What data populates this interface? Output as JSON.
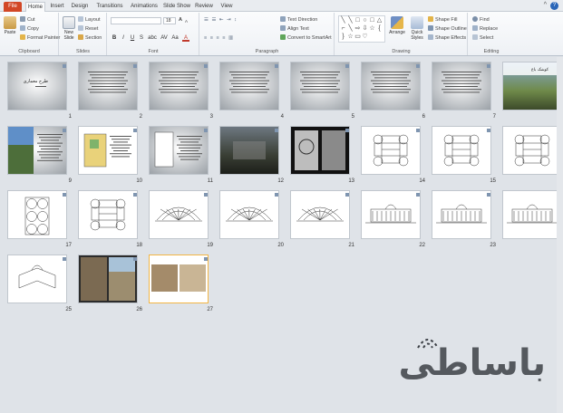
{
  "tabs": [
    "File",
    "Home",
    "Insert",
    "Design",
    "Transitions",
    "Animations",
    "Slide Show",
    "Review",
    "View"
  ],
  "active_tab": "Home",
  "help_label": "?",
  "minimize_label": "^",
  "groups": {
    "clipboard": {
      "label": "Clipboard",
      "paste": "Paste",
      "cut": "Cut",
      "copy": "Copy",
      "format_painter": "Format Painter"
    },
    "slides": {
      "label": "Slides",
      "new_slide": "New Slide",
      "layout": "Layout",
      "reset": "Reset",
      "section": "Section"
    },
    "font": {
      "label": "Font",
      "font_name": "",
      "font_size": "18",
      "bold": "B",
      "italic": "I",
      "underline": "U",
      "strike": "S",
      "shadow": "abc",
      "spacing": "AV",
      "case": "Aa",
      "color": "A"
    },
    "paragraph": {
      "label": "Paragraph",
      "text_direction": "Text Direction",
      "align_text": "Align Text",
      "smartart": "Convert to SmartArt"
    },
    "drawing": {
      "label": "Drawing",
      "arrange": "Arrange",
      "quick_styles": "Quick Styles",
      "shape_fill": "Shape Fill",
      "shape_outline": "Shape Outline",
      "shape_effects": "Shape Effects"
    },
    "editing": {
      "label": "Editing",
      "find": "Find",
      "replace": "Replace",
      "select": "Select"
    }
  },
  "slides": [
    {
      "n": "1",
      "kind": "title"
    },
    {
      "n": "2",
      "kind": "text"
    },
    {
      "n": "3",
      "kind": "text"
    },
    {
      "n": "4",
      "kind": "text"
    },
    {
      "n": "5",
      "kind": "text"
    },
    {
      "n": "6",
      "kind": "text"
    },
    {
      "n": "7",
      "kind": "text"
    },
    {
      "n": "8",
      "kind": "photo-title"
    },
    {
      "n": "9",
      "kind": "photo-text"
    },
    {
      "n": "10",
      "kind": "plan-color"
    },
    {
      "n": "11",
      "kind": "plan-text"
    },
    {
      "n": "12",
      "kind": "photo-dark"
    },
    {
      "n": "13",
      "kind": "photo-bw"
    },
    {
      "n": "14",
      "kind": "plan"
    },
    {
      "n": "15",
      "kind": "plan"
    },
    {
      "n": "16",
      "kind": "plan"
    },
    {
      "n": "17",
      "kind": "plan-circles"
    },
    {
      "n": "18",
      "kind": "plan"
    },
    {
      "n": "19",
      "kind": "section"
    },
    {
      "n": "20",
      "kind": "section"
    },
    {
      "n": "21",
      "kind": "section"
    },
    {
      "n": "22",
      "kind": "elevation"
    },
    {
      "n": "23",
      "kind": "elevation"
    },
    {
      "n": "24",
      "kind": "elevation"
    },
    {
      "n": "25",
      "kind": "perspective"
    },
    {
      "n": "26",
      "kind": "photo-pair"
    },
    {
      "n": "27",
      "kind": "photo-interior"
    }
  ],
  "slide_title_texts": {
    "1": "طرح معماری",
    "8": "کوشک باغ"
  },
  "watermark_text": "باساطی",
  "colors": {
    "file_tab": "#d24726",
    "accent_blue": "#2a66b8",
    "selection": "#f2b544"
  }
}
